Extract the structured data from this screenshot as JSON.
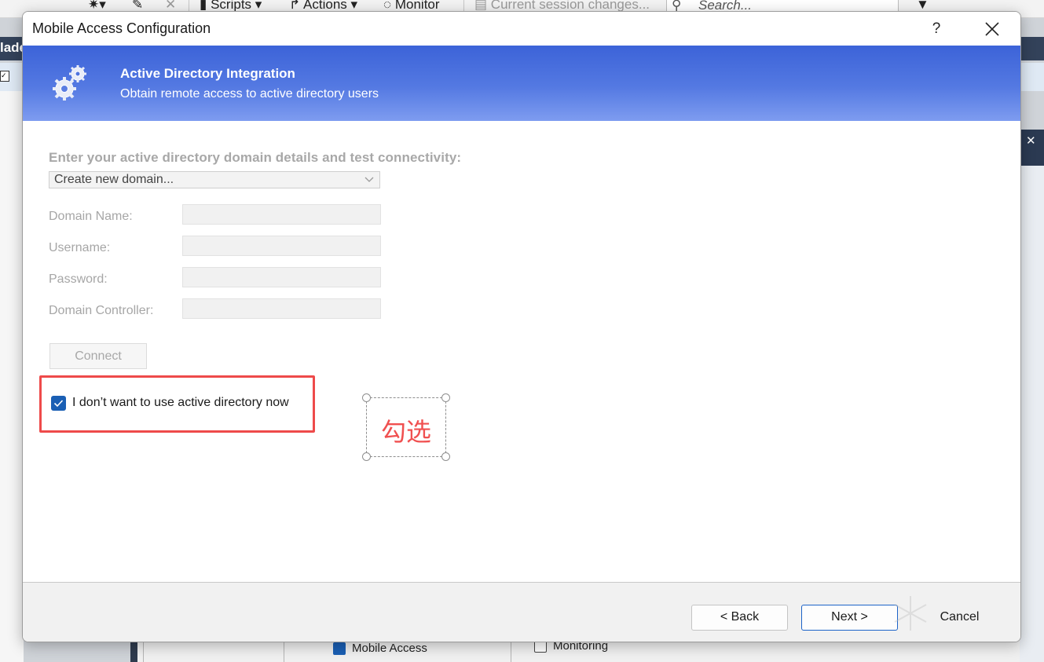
{
  "background": {
    "toolbar": {
      "scripts_label": "Scripts",
      "actions_label": "Actions",
      "monitor_label": "Monitor",
      "session_label": "Current session changes...",
      "search_placeholder": "Search..."
    },
    "left_label": "lade",
    "bottom": {
      "mobile_access_label": "Mobile Access",
      "monitoring_label": "Monitoring"
    }
  },
  "dialog": {
    "title": "Mobile Access Configuration",
    "help_label": "?",
    "banner": {
      "title": "Active Directory Integration",
      "subtitle": "Obtain remote access to active directory users"
    },
    "form": {
      "instruction": "Enter your active directory domain details and test connectivity:",
      "domain_select": "Create new domain...",
      "fields": [
        {
          "label": "Domain Name:",
          "value": ""
        },
        {
          "label": "Username:",
          "value": ""
        },
        {
          "label": "Password:",
          "value": ""
        },
        {
          "label": "Domain Controller:",
          "value": ""
        }
      ],
      "connect_label": "Connect",
      "skip_ad_checkbox": {
        "label": "I don’t want to use active directory now",
        "checked": true
      }
    },
    "annotation": {
      "text": "勾选",
      "highlight_color": "#ee4a4a"
    },
    "footer": {
      "back_label": "< Back",
      "next_label": "Next >",
      "cancel_label": "Cancel"
    }
  },
  "colors": {
    "banner_top": "#3c63d8",
    "banner_bottom": "#7e9cf0",
    "checkbox": "#1a5fb4",
    "primary_border": "#1c63c8"
  }
}
